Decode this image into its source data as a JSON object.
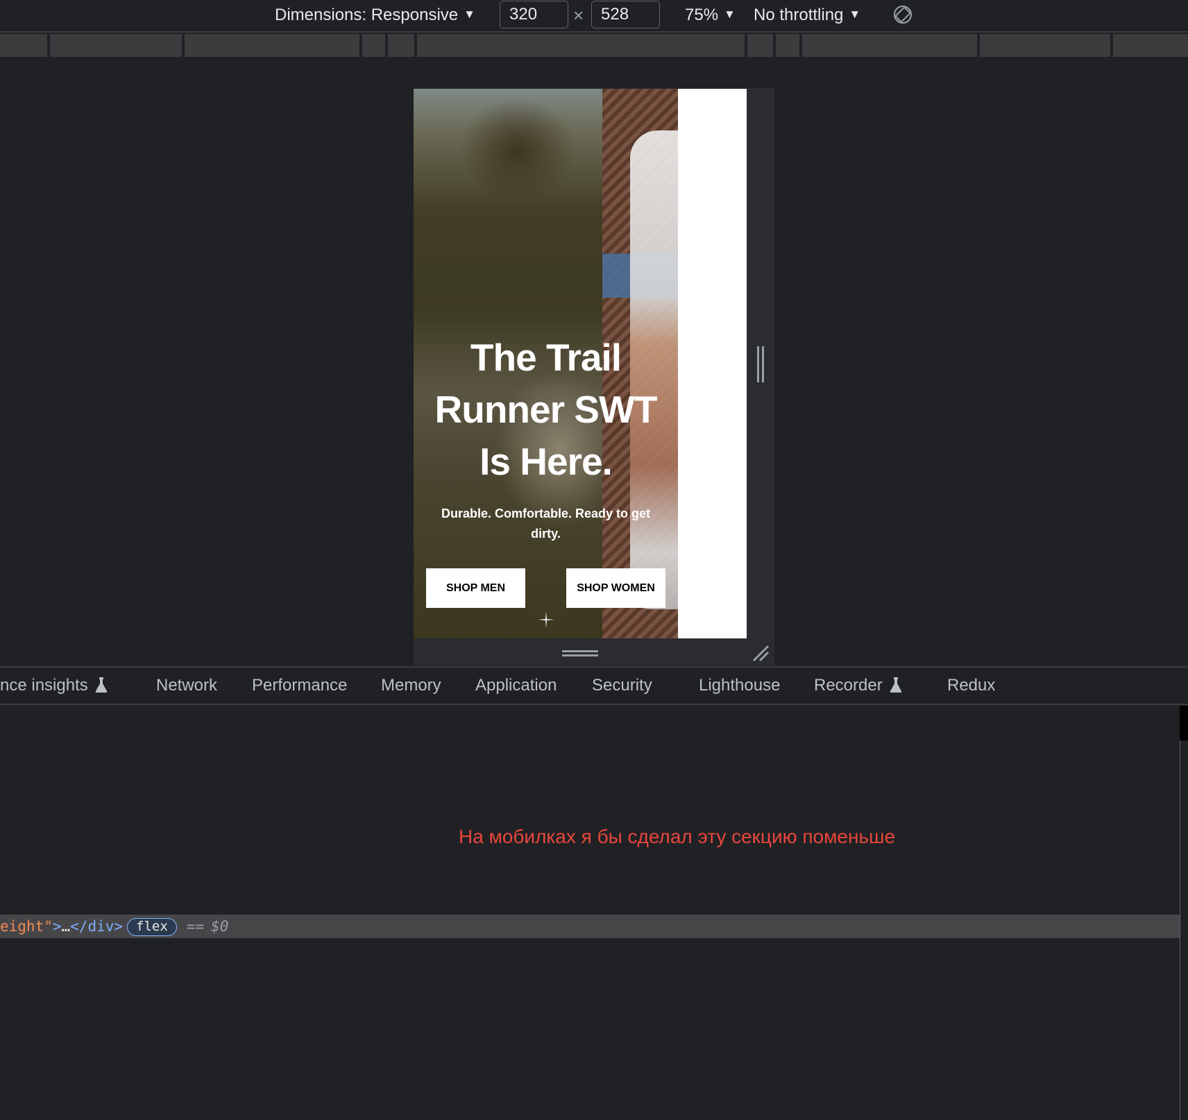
{
  "toolbar": {
    "dimensions_label": "Dimensions: Responsive",
    "width_value": "320",
    "times_sign": "×",
    "height_value": "528",
    "zoom_label": "75%",
    "throttling_label": "No throttling",
    "caret": "▼"
  },
  "hero": {
    "title_line1": "The Trail",
    "title_line2": "Runner SWT",
    "title_line3": "Is Here.",
    "subtitle_line1": "Durable. Comfortable. Ready to get",
    "subtitle_line2": "dirty.",
    "shop_men_label": "SHOP MEN",
    "shop_women_label": "SHOP WOMEN"
  },
  "tabs": [
    {
      "label": "nce insights"
    },
    {
      "label": "Network"
    },
    {
      "label": "Performance"
    },
    {
      "label": "Memory"
    },
    {
      "label": "Application"
    },
    {
      "label": "Security"
    },
    {
      "label": "Lighthouse"
    },
    {
      "label": "Recorder"
    },
    {
      "label": "Redux"
    }
  ],
  "annotation": "На мобилках я бы сделал эту секцию поменьше",
  "dom_row": {
    "attr_tail": "eight\"",
    "tag_open_end": ">",
    "ellipsis": "…",
    "tag_close": "</div>",
    "badge": "flex",
    "equals": "==",
    "dollar": "$0"
  },
  "colors": {
    "background": "#202124",
    "annotation": "#e7463c",
    "selected_row": "#464649"
  }
}
